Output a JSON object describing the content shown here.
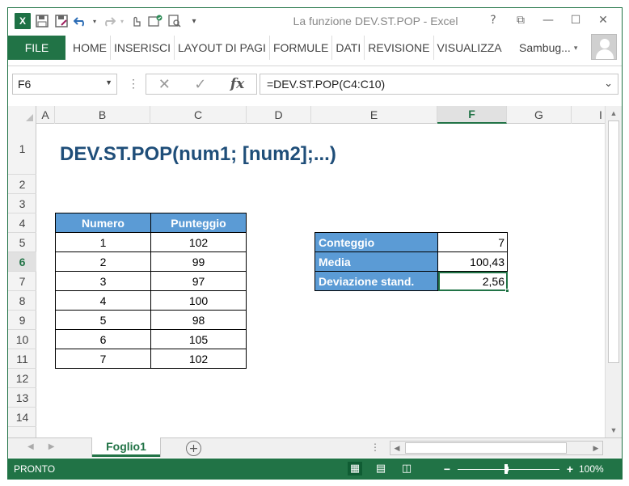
{
  "titlebar": {
    "title": "La funzione DEV.ST.POP - Excel",
    "icons": [
      "excel-logo",
      "save-icon",
      "save-as-icon",
      "undo-icon",
      "redo-icon",
      "touch-mode-icon",
      "spell-check-icon",
      "print-preview-icon",
      "customize-qat-icon"
    ],
    "logo_letter": "X",
    "help": "?",
    "ribbon_display": "⧉",
    "minimize": "—",
    "maximize": "☐",
    "close": "✕"
  },
  "ribbon": {
    "file": "FILE",
    "tabs": [
      "HOME",
      "INSERISCI",
      "LAYOUT DI PAGI",
      "FORMULE",
      "DATI",
      "REVISIONE",
      "VISUALIZZA"
    ],
    "user": "Sambug..."
  },
  "formula_bar": {
    "name_box": "F6",
    "cancel": "✕",
    "enter": "✓",
    "fx": "fx",
    "formula": "=DEV.ST.POP(C4:C10)"
  },
  "grid": {
    "columns": [
      "A",
      "B",
      "C",
      "D",
      "E",
      "F",
      "G",
      "I"
    ],
    "selected_column": "F",
    "rows": [
      "1",
      "2",
      "3",
      "4",
      "5",
      "6",
      "7",
      "8",
      "9",
      "10",
      "11",
      "12",
      "13",
      "14"
    ],
    "selected_row": "6"
  },
  "sheet": {
    "title": "DEV.ST.POP(num1; [num2];...)",
    "table1": {
      "headers": [
        "Numero",
        "Punteggio"
      ],
      "rows": [
        [
          "1",
          "102"
        ],
        [
          "2",
          "99"
        ],
        [
          "3",
          "97"
        ],
        [
          "4",
          "100"
        ],
        [
          "5",
          "98"
        ],
        [
          "6",
          "105"
        ],
        [
          "7",
          "102"
        ]
      ]
    },
    "table2": {
      "rows": [
        [
          "Conteggio",
          "7"
        ],
        [
          "Media",
          "100,43"
        ],
        [
          "Deviazione stand.",
          "2,56"
        ]
      ]
    }
  },
  "sheet_tabs": {
    "active": "Foglio1",
    "add": "+"
  },
  "status_bar": {
    "ready": "PRONTO",
    "zoom": "100%",
    "zoom_level": 1.0
  },
  "colors": {
    "accent": "#217346",
    "header_fill": "#5b9bd5",
    "title_text": "#1f4e79"
  }
}
